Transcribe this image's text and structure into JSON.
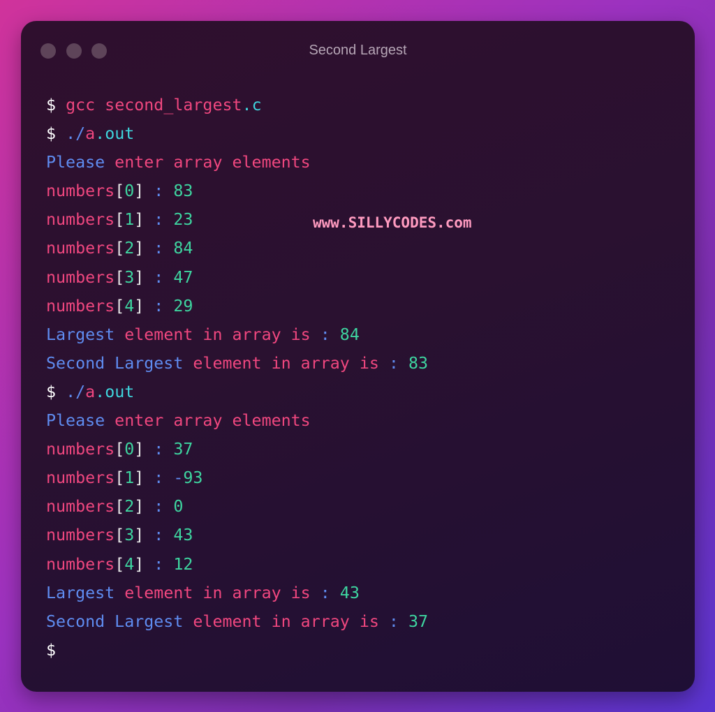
{
  "window": {
    "title": "Second Largest",
    "buttons": [
      "close",
      "minimize",
      "maximize"
    ]
  },
  "watermark": "www.SILLYCODES.com",
  "colors": {
    "prompt": "#ffffff",
    "keyword": "#f0477f",
    "extension": "#3fd4dc",
    "label": "#5f8cf0",
    "value": "#3ed5a0"
  },
  "terminal": {
    "prompt_symbol": "$",
    "compile_cmd": {
      "cmd": "gcc",
      "file": "second_largest",
      "dot": ".",
      "ext": "c"
    },
    "run_cmd": {
      "prefix": "./",
      "name": "a",
      "dot": ".",
      "ext": "out"
    },
    "enter_msg": {
      "first": "Please",
      "rest": " enter array elements"
    },
    "array_name": "numbers",
    "separator": " : ",
    "largest_msg": {
      "first": "Largest",
      "rest": " element in array is"
    },
    "second_msg": {
      "first": "Second Largest",
      "rest": " element in array is"
    },
    "runs": [
      {
        "inputs": [
          {
            "index": "0",
            "value": "83"
          },
          {
            "index": "1",
            "value": "23"
          },
          {
            "index": "2",
            "value": "84"
          },
          {
            "index": "3",
            "value": "47"
          },
          {
            "index": "4",
            "value": "29"
          }
        ],
        "largest": "84",
        "second_largest": "83"
      },
      {
        "inputs": [
          {
            "index": "0",
            "value": "37"
          },
          {
            "index": "1",
            "sign": "-",
            "value": "93"
          },
          {
            "index": "2",
            "value": "0"
          },
          {
            "index": "3",
            "value": "43"
          },
          {
            "index": "4",
            "value": "12"
          }
        ],
        "largest": "43",
        "second_largest": "37"
      }
    ]
  }
}
